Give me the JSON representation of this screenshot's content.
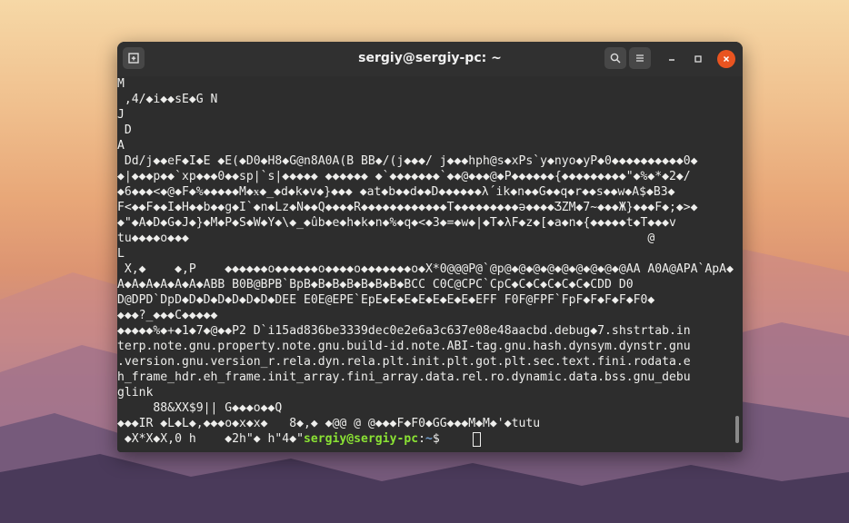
{
  "window": {
    "title": "sergiy@sergiy-pc: ~"
  },
  "terminal": {
    "lines": [
      "M",
      " ,4/◆i◆◆sE◆G N",
      "J",
      " D",
      "A",
      " Dd/j◆◆eF◆I◆E ◆E(◆D0◆H8◆G@n8A0A(B BB◆/(j◆◆◆/ j◆◆◆hph@s◆xPs`y◆nyo◆yP◆0◆◆◆◆◆◆◆◆◆◆0◆",
      "◆|◆◆◆p◆◆`xp◆◆◆0◆◆sp|`s|◆◆◆◆◆ ◆◆◆◆◆◆ ◆`◆◆◆◆◆◆◆`◆◆@◆◆◆@◆P◆◆◆◆◆◆{◆◆◆◆◆◆◆◆◆\"◆%◆*◆2◆/",
      "◆6◆◆◆<◆@◆F◆%◆◆◆◆◆M◆ӿ◆_◆d◆k◆v◆}◆◆◆ ◆at◆b◆◆d◆◆D◆◆◆◆◆◆λ́ ik◆n◆◆G◆◆q◆r◆◆s◆◆w◆A$◆B3◆",
      "F<◆◆F◆◆I◆H◆◆b◆◆g◆I`◆n◆Lz◆N◆◆Q◆◆◆◆R◆◆◆◆◆◆◆◆◆◆◆◆T◆◆◆◆◆◆◆◆◆ə◆◆◆◆ƷZM◆7~◆◆◆Ж}◆◆◆F◆;◆>◆",
      "◆\"◆A◆D◆G◆J◆}◆M◆P◆S◆W◆Y◆\\◆_◆ûb◆e◆h◆k◆n◆%◆q◆<◆3◆=◆w◆|◆T◆λF◆z◆[◆a◆n◆{◆◆◆◆◆t◆T◆◆◆v",
      "tu◆◆◆◆o◆◆◆                                                                @",
      "L",
      " X,◆    ◆,P    ◆◆◆◆◆◆o◆◆◆◆◆◆o◆◆◆◆o◆◆◆◆◆◆◆o◆X*0@@@P@`@p@◆@◆@◆@◆@◆@◆@◆@◆@AA A0A@APA`ApA◆",
      "A◆A◆A◆A◆A◆A◆ABB B0B@BPB`BpB◆B◆B◆B◆B◆B◆B◆BCC C0C@CPC`CpC◆C◆C◆C◆C◆C◆CDD D0",
      "D@DPD`DpD◆D◆D◆D◆D◆D◆D◆DEE E0E@EPE`EpE◆E◆E◆E◆E◆E◆E◆EFF F0F@FPF`FpF◆F◆F◆F◆F0◆",
      "◆◆◆?̲◆◆◆C◆◆◆◆◆",
      "◆◆◆◆◆%◆+◆1◆7◆@◆◆P2 D`i15ad836be3339dec0e2e6a3c637e08e48aacbd.debug◆7.shstrtab.in",
      "terp.note.gnu.property.note.gnu.build-id.note.ABI-tag.gnu.hash.dynsym.dynstr.gnu",
      ".version.gnu.version_r.rela.dyn.rela.plt.init.plt.got.plt.sec.text.fini.rodata.e",
      "h_frame_hdr.eh_frame.init_array.fini_array.data.rel.ro.dynamic.data.bss.gnu_debu",
      "glink",
      "     88&XX$9|| G◆◆◆o◆◆Q",
      "◆◆◆IR ◆L◆L◆,◆◆◆o◆x◆x◆   8◆,◆ ◆@@ @ @◆◆◆F◆F0◆GG◆◆◆M◆M◆'◆tutu"
    ],
    "prompt_prefix": " ◆X*X◆X,0 h    ◆2h\"◆ h\"4◆\"",
    "prompt_user_host": "sergiy@sergiy-pc",
    "prompt_path_sep": ":",
    "prompt_path": "~",
    "prompt_symbol": "$ "
  }
}
